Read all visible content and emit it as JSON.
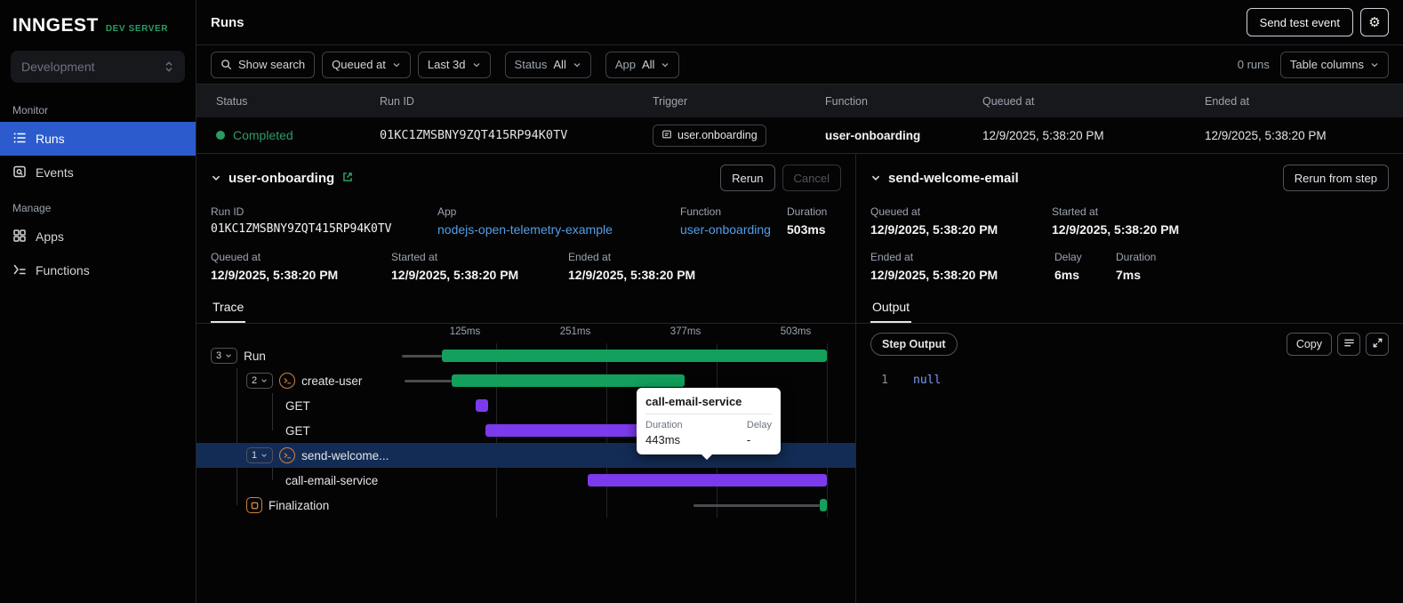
{
  "colors": {
    "accent_blue": "#2b5bcc",
    "status_green": "#2c9b63",
    "bar_green": "#12a05c",
    "bar_purple": "#7c3aed",
    "link_blue": "#539fe8",
    "selected_row": "#132c55"
  },
  "icons": {
    "gear": "⚙"
  },
  "sidebar": {
    "logo": "INNGEST",
    "badge": "DEV SERVER",
    "environment": "Development",
    "sections": [
      {
        "label": "Monitor",
        "items": [
          {
            "label": "Runs"
          },
          {
            "label": "Events"
          }
        ]
      },
      {
        "label": "Manage",
        "items": [
          {
            "label": "Apps"
          },
          {
            "label": "Functions"
          }
        ]
      }
    ]
  },
  "header": {
    "title": "Runs",
    "send_test_event": "Send test event"
  },
  "filters": {
    "show_search": "Show search",
    "queued_at": "Queued at",
    "time_range": "Last 3d",
    "status_label": "Status",
    "status_value": "All",
    "app_label": "App",
    "app_value": "All",
    "runs_count": "0 runs",
    "table_columns": "Table columns"
  },
  "runs_table": {
    "columns": [
      "Status",
      "Run ID",
      "Trigger",
      "Function",
      "Queued at",
      "Ended at"
    ],
    "row": {
      "status": "Completed",
      "run_id": "01KC1ZMSBNY9ZQT415RP94K0TV",
      "trigger": "user.onboarding",
      "function": "user-onboarding",
      "queued_at": "12/9/2025, 5:38:20 PM",
      "ended_at": "12/9/2025, 5:38:20 PM"
    }
  },
  "run_detail": {
    "title": "user-onboarding",
    "rerun": "Rerun",
    "cancel": "Cancel",
    "run_id_label": "Run ID",
    "run_id": "01KC1ZMSBNY9ZQT415RP94K0TV",
    "app_label": "App",
    "app_name": "nodejs-open-telemetry-example",
    "function_label": "Function",
    "function_name": "user-onboarding",
    "duration_label": "Duration",
    "duration": "503ms",
    "queued_label": "Queued at",
    "queued_at": "12/9/2025, 5:38:20 PM",
    "started_label": "Started at",
    "started_at": "12/9/2025, 5:38:20 PM",
    "ended_label": "Ended at",
    "ended_at": "12/9/2025, 5:38:20 PM",
    "tab": "Trace"
  },
  "trace": {
    "axis": [
      "125ms",
      "251ms",
      "377ms",
      "503ms"
    ],
    "rows": [
      {
        "count": "3",
        "label": "Run"
      },
      {
        "count": "2",
        "label": "create-user"
      },
      {
        "label": "GET"
      },
      {
        "label": "GET"
      },
      {
        "count": "1",
        "label": "send-welcome..."
      },
      {
        "label": "call-email-service"
      },
      {
        "label": "Finalization"
      }
    ],
    "tooltip": {
      "title": "call-email-service",
      "duration_label": "Duration",
      "duration_value": "443ms",
      "delay_label": "Delay",
      "delay_value": "-"
    }
  },
  "step_detail": {
    "title": "send-welcome-email",
    "rerun_from_step": "Rerun from step",
    "queued_label": "Queued at",
    "queued_at": "12/9/2025, 5:38:20 PM",
    "started_label": "Started at",
    "started_at": "12/9/2025, 5:38:20 PM",
    "ended_label": "Ended at",
    "ended_at": "12/9/2025, 5:38:20 PM",
    "delay_label": "Delay",
    "delay": "6ms",
    "duration_label": "Duration",
    "duration": "7ms",
    "tab": "Output",
    "step_output": "Step Output",
    "copy": "Copy",
    "code_line": "1",
    "code_value": "null"
  }
}
